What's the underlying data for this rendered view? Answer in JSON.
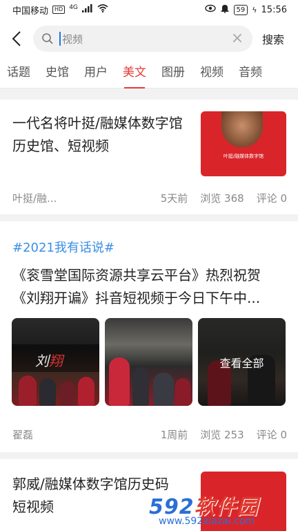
{
  "status_bar": {
    "carrier": "中国移动",
    "hd": "HD",
    "network": "4G",
    "battery": "59",
    "time": "15:56"
  },
  "search": {
    "value": "视频",
    "submit_label": "搜索"
  },
  "tabs": [
    {
      "label": "话题",
      "active": false
    },
    {
      "label": "史馆",
      "active": false
    },
    {
      "label": "用户",
      "active": false
    },
    {
      "label": "美文",
      "active": true
    },
    {
      "label": "图册",
      "active": false
    },
    {
      "label": "视频",
      "active": false
    },
    {
      "label": "音频",
      "active": false
    }
  ],
  "articles": [
    {
      "title_line1": "一代名将叶挺/融媒体数字馆",
      "title_line2": "历史馆、短视频",
      "thumb_caption": "叶挺/融媒体数字馆",
      "author": "叶挺/融...",
      "time": "5天前",
      "views": "浏览 368",
      "comments": "评论 0"
    },
    {
      "hashtag": "#2021我有话说#",
      "title_line1": "《衮雪堂国际资源共享云平台》热烈祝贺",
      "title_line2": "《刘翔开谝》抖音短视频于今日下午中...",
      "photos_overlay": "查看全部",
      "author": "翟磊",
      "time": "1周前",
      "views": "浏览 253",
      "comments": "评论 0"
    },
    {
      "title_line1": "郭威/融媒体数字馆历史码",
      "title_line2": "短视频"
    }
  ],
  "watermark": {
    "brand_num": "592",
    "brand_text": "软件园",
    "url": "www.592xiazai.com"
  },
  "colors": {
    "accent": "#e53a3a",
    "hashtag": "#3a8ee6",
    "thumb_red": "#d9252a"
  }
}
